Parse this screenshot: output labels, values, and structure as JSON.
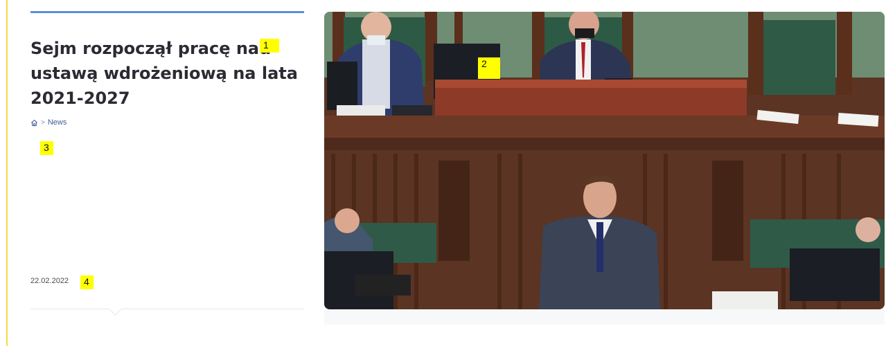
{
  "article": {
    "title": "Sejm rozpoczął pracę nad ustawą wdrożeniową na lata 2021-2027",
    "breadcrumb": {
      "home_icon": "home-icon",
      "separator": ">",
      "current": "News"
    },
    "date": "22.02.2022",
    "image": {
      "subject": "Sejm session photo"
    }
  },
  "annotations": [
    {
      "label": "1"
    },
    {
      "label": "2"
    },
    {
      "label": "3"
    },
    {
      "label": "4"
    }
  ],
  "colors": {
    "accent_bar": "#5b8fd8",
    "left_rule": "#f5dc43",
    "title": "#2b2b33",
    "link": "#3d5e9a",
    "tag_bg": "#ffff00"
  }
}
